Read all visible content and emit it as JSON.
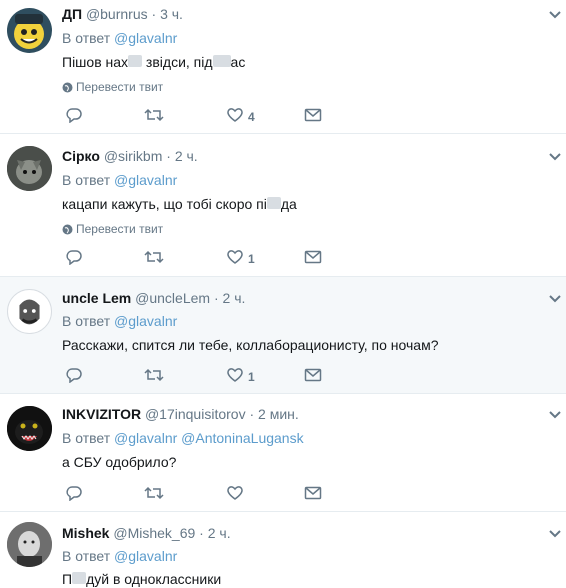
{
  "translate_label": "Перевести твит",
  "reply_prefix": "В ответ",
  "tweets": [
    {
      "name": "ДП",
      "handle": "@burnrus",
      "time": "3 ч.",
      "reply_to": [
        "@glavalnr"
      ],
      "text_parts": [
        "Пішов нах",
        "█",
        " звідси, під",
        "██",
        "ас"
      ],
      "translate": true,
      "likes": "4",
      "highlighted": false
    },
    {
      "name": "Сірко",
      "handle": "@sirikbm",
      "time": "2 ч.",
      "reply_to": [
        "@glavalnr"
      ],
      "text_parts": [
        "кацапи кажуть, що тобі скоро пі",
        "█",
        "да"
      ],
      "translate": true,
      "likes": "1",
      "highlighted": false
    },
    {
      "name": "uncle Lem",
      "handle": "@uncleLem",
      "time": "2 ч.",
      "reply_to": [
        "@glavalnr"
      ],
      "text": "Расскажи, спится ли тебе, коллаборационисту, по ночам?",
      "translate": false,
      "likes": "1",
      "highlighted": true
    },
    {
      "name": "INKVIZITOR",
      "handle": "@17inquisitorov",
      "time": "2 мин.",
      "reply_to": [
        "@glavalnr",
        "@AntoninaLugansk"
      ],
      "text": "а СБУ одобрило?",
      "translate": false,
      "likes": "",
      "highlighted": false
    },
    {
      "name": "Mishek",
      "handle": "@Mishek_69",
      "time": "2 ч.",
      "reply_to": [
        "@glavalnr"
      ],
      "text_parts": [
        "П",
        "█",
        "дуй в одноклассники"
      ],
      "translate": false,
      "likes": "",
      "highlighted": false
    }
  ]
}
